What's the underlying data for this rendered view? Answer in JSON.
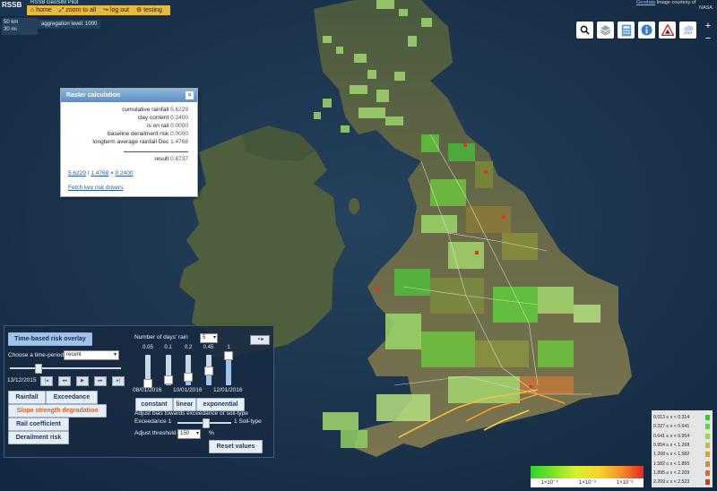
{
  "app": {
    "logo": "RSSB",
    "title": "RSSB GeoSIM Pilot",
    "nav": [
      "home",
      "zoom to all",
      "log out",
      "testing"
    ],
    "coords": [
      "50 km",
      "30 mi"
    ],
    "aggregation": "aggregation level: 1000",
    "attribution_link": "Geodata",
    "attribution_text": "Image courtesy of",
    "attribution_text2": "NASA"
  },
  "tools": [
    "search-icon",
    "layers-icon",
    "calculator-icon",
    "info-icon",
    "warning-sign-icon",
    "rain-cloud-icon"
  ],
  "zoom": {
    "in": "+",
    "out": "−"
  },
  "raster": {
    "title": "Raster calculation",
    "close": "×",
    "rows": [
      {
        "label": "cumulative rainfall",
        "value": "5.6229"
      },
      {
        "label": "clay content",
        "value": "0.2400"
      },
      {
        "label": "is on rail",
        "value": "0.0000"
      },
      {
        "label": "baseline derailment risk",
        "value": "0.0000"
      },
      {
        "label": "longterm average rainfall Dec",
        "value": "1.4768"
      }
    ],
    "result_label": "result",
    "result_value": "0.8737",
    "formula_a": "5.6229",
    "formula_sep1": "/",
    "formula_b": "1.4768",
    "formula_sep2": "×",
    "formula_c": "0.2400",
    "fetch_link": "Fetch key risk drivers"
  },
  "panel": {
    "tab_title": "Time-based risk overlay",
    "period_label": "Choose a time-period",
    "period_value": "recent",
    "date": "13/12/2015",
    "buttons": [
      "Rainfall",
      "Exceedance",
      "Slope strength degradation",
      "Rail coefficient",
      "Derailment risk"
    ],
    "active_button": "Slope strength degradation",
    "days_label": "Number of days' rain",
    "days_value": "5",
    "weights": [
      "0.05",
      "0.1",
      "0.2",
      "0.45",
      "1"
    ],
    "weight_levels": [
      0.1,
      0.2,
      0.3,
      0.5,
      1.0
    ],
    "dates": [
      "08/01/2016",
      "10/01/2016",
      "12/01/2016"
    ],
    "modes": [
      "constant",
      "linear",
      "exponential"
    ],
    "bias_label": "Adjust bias towards exceedance or soil-type",
    "exceedance_label": "Exceedance",
    "exceedance_val": "1",
    "soil_label": "Soil-type",
    "soil_val": "1",
    "threshold_label": "Adjust threshold",
    "threshold_value": "150",
    "threshold_unit": "%",
    "reset": "Reset values",
    "panel_toggle": "▪ ▸"
  },
  "legend": {
    "rows": [
      {
        "text": "0.013 ≤ x < 0.314",
        "color": "#2fcf2f"
      },
      {
        "text": "0.327 ≤ x < 0.641",
        "color": "#5fd92e"
      },
      {
        "text": "0.641 ≤ x < 0.954",
        "color": "#98df2d"
      },
      {
        "text": "0.954 ≤ x < 1.268",
        "color": "#c9c22c"
      },
      {
        "text": "1.268 ≤ x < 1.582",
        "color": "#d8a42c"
      },
      {
        "text": "1.582 ≤ x < 1.895",
        "color": "#d98b2c"
      },
      {
        "text": "1.895 ≤ x < 2.209",
        "color": "#d96a2c"
      },
      {
        "text": "2.209 ≤ x < 2.523",
        "color": "#e0332a"
      }
    ]
  },
  "scale": {
    "ticks": [
      "1×10⁻⁴",
      "1×10⁻³",
      "1×10⁻²"
    ]
  }
}
